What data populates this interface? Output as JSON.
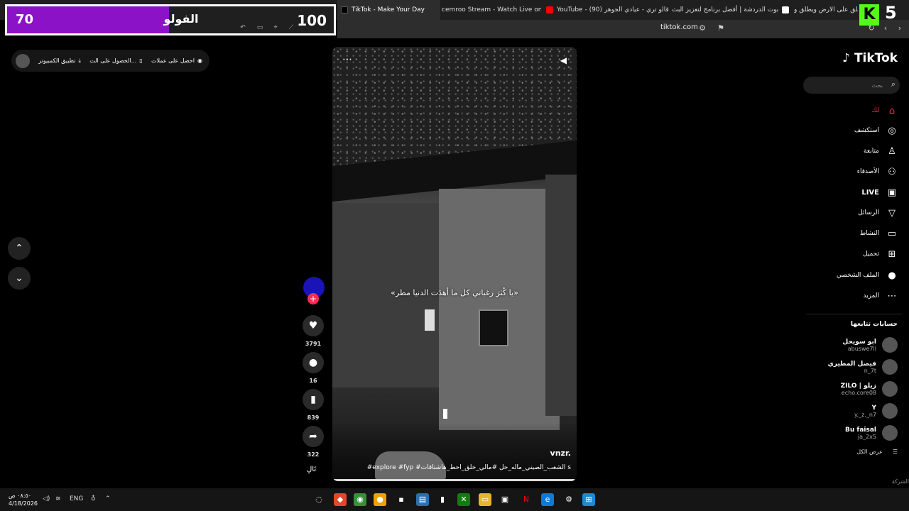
{
  "browser": {
    "tabs": [
      {
        "label": "100",
        "color": "#444"
      },
      {
        "label": "TikTok - Make Your Day",
        "color": "#000"
      },
      {
        "label": "cemroo Stream - Watch Live on Kick",
        "color": "#53fc18"
      },
      {
        "label": "YouTube - (90) قالو تري - عيادي الجوهر",
        "color": "#ff0000"
      },
      {
        "label": "بوت الدردشة | أفضل برنامج لتعزيز البث",
        "color": "#fff"
      },
      {
        "label": "يطلق على الارض ويطلق و...",
        "color": "#ccc"
      }
    ],
    "url": "tiktok.com"
  },
  "overlay": {
    "left_value": "70",
    "title": "الفولو",
    "right_value": "100",
    "progress_fraction": 0.7,
    "accent": "#8b12c7"
  },
  "kick": {
    "logo": "K",
    "number": "5",
    "color": "#53fc18"
  },
  "top_pill": {
    "get_coins": "احصل على عملات",
    "get_app": "الحصول على الت...",
    "desktop_app": "تطبيق الكمبيوتر"
  },
  "video": {
    "caption": "«يا كُثرَ رغباتي كل ما أهدَت الدنيا مطر»",
    "author": "vnzr.",
    "hashtags": "#explore #fyp #الشعب_الصيني_ماله_حل #مالي_خلق_احط_هاشتاقات s",
    "progress_fraction": 0.99
  },
  "actions": {
    "likes": "3791",
    "comments": "16",
    "saves": "839",
    "shares": "322",
    "next_label": "تَالِ"
  },
  "sidebar": {
    "logo": "TikTok",
    "search_placeholder": "بحث",
    "nav": [
      {
        "label": "لك",
        "icon": "home-icon",
        "glyph": "⌂",
        "active": true
      },
      {
        "label": "استكشف",
        "icon": "compass-icon",
        "glyph": "◎"
      },
      {
        "label": "متابعة",
        "icon": "following-icon",
        "glyph": "♙"
      },
      {
        "label": "الأصدقاء",
        "icon": "friends-icon",
        "glyph": "⚇"
      },
      {
        "label": "LIVE",
        "icon": "live-icon",
        "glyph": "▣"
      },
      {
        "label": "الرسائل",
        "icon": "messages-icon",
        "glyph": "▽"
      },
      {
        "label": "النشاط",
        "icon": "activity-icon",
        "glyph": "▭"
      },
      {
        "label": "تحميل",
        "icon": "upload-icon",
        "glyph": "⊞"
      },
      {
        "label": "الملف الشخصي",
        "icon": "profile-icon",
        "glyph": "●"
      },
      {
        "label": "المزيد",
        "icon": "more-icon",
        "glyph": "⋯"
      }
    ],
    "following_title": "حسابات تتابعها",
    "accounts": [
      {
        "name": "ابو سويحل",
        "handle": "abuswe7ll"
      },
      {
        "name": "فيصل المطيري",
        "handle": "n_7t"
      },
      {
        "name": "ZILO | زيلو",
        "handle": "echo.core08"
      },
      {
        "name": "Y",
        "handle": "y._z._n7"
      },
      {
        "name": "Bu faisal",
        "handle": "ja_2x5"
      }
    ],
    "see_all": "عرض الكل",
    "company": "الشركة"
  },
  "taskbar": {
    "time": "٠٨:٥٠ ص",
    "date": "4/18/2026",
    "lang": "ENG"
  }
}
